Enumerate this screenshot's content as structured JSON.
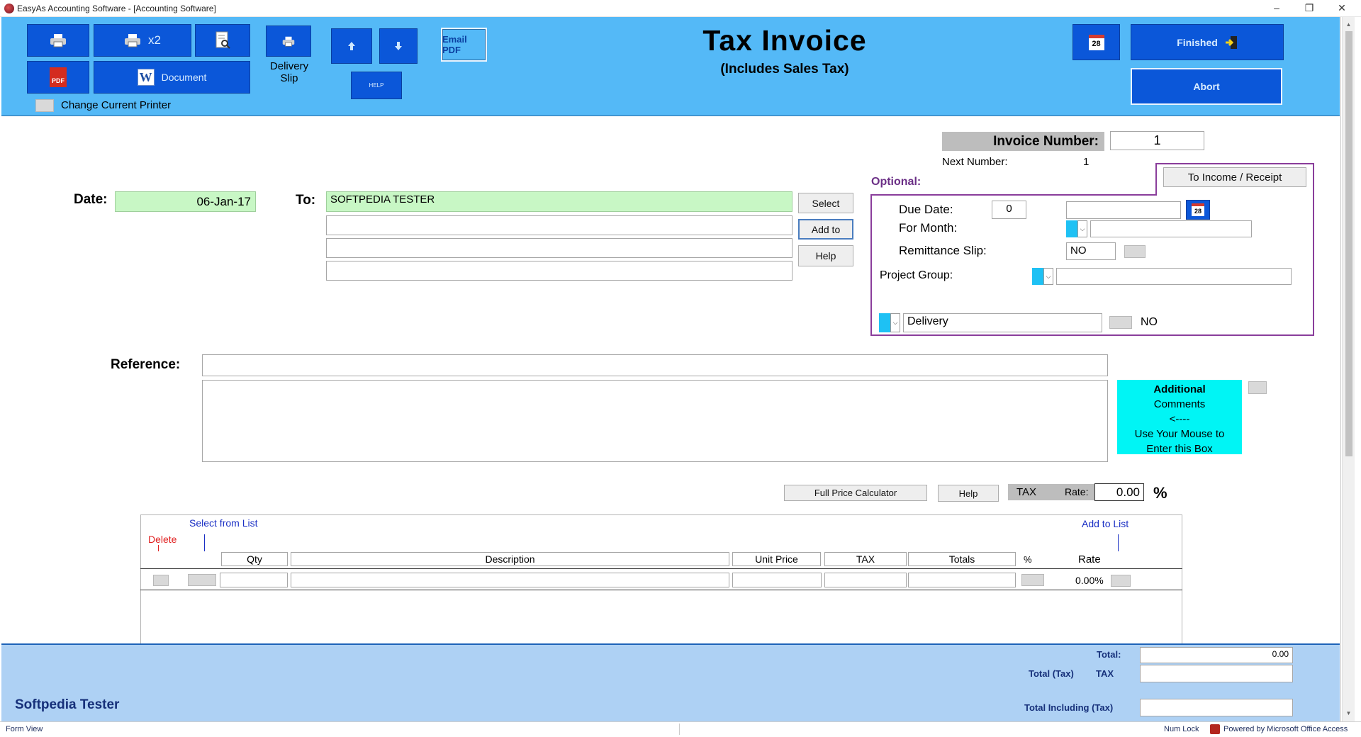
{
  "window": {
    "title": "EasyAs Accounting Software - [Accounting Software]",
    "minimize": "–",
    "restore": "❐",
    "close": "✕"
  },
  "toolbar": {
    "print_x2_label": "x2",
    "document_label": "Document",
    "delivery_slip_label": "Delivery Slip",
    "help_label": "HELP",
    "email_pdf_label": "Email PDF",
    "change_printer_label": "Change Current Printer",
    "pdf_icon_text": "PDF",
    "word_icon_text": "W",
    "calendar_icon_text": "28"
  },
  "header": {
    "title": "Tax  Invoice",
    "subtitle": "(Includes Sales Tax)",
    "finished_label": "Finished",
    "abort_label": "Abort"
  },
  "invoice": {
    "number_label": "Invoice Number:",
    "number_value": "1",
    "next_number_label": "Next Number:",
    "next_number_value": "1"
  },
  "date": {
    "label": "Date:",
    "value": "06-Jan-17"
  },
  "to": {
    "label": "To:",
    "lines": [
      "SOFTPEDIA TESTER",
      "",
      "",
      ""
    ],
    "select_label": "Select",
    "add_to_label": "Add to",
    "help_label": "Help"
  },
  "optional": {
    "label": "Optional:",
    "to_income_label": "To Income / Receipt",
    "due_date_label": "Due Date:",
    "due_date_days": "0",
    "due_date_value": "",
    "for_month_label": "For Month:",
    "for_month_value": "",
    "remittance_label": "Remittance Slip:",
    "remittance_value": "NO",
    "project_group_label": "Project Group:",
    "project_group_value": "",
    "delivery_value": "Delivery",
    "delivery_flag": "NO"
  },
  "reference": {
    "label": "Reference:",
    "value": "",
    "notes": "",
    "additional_comments": [
      "Additional",
      "Comments",
      "<----",
      "Use Your Mouse to",
      "Enter this Box"
    ]
  },
  "calc": {
    "full_price_label": "Full Price Calculator",
    "help_label": "Help",
    "tax_label": "TAX",
    "rate_label": "Rate:",
    "rate_value": "0.00",
    "percent_sign": "%"
  },
  "items": {
    "select_from_list": "Select from List",
    "add_to_list": "Add to List",
    "delete_label": "Delete",
    "columns": [
      "Qty",
      "Description",
      "Unit Price",
      "TAX",
      "Totals"
    ],
    "percent_col": "%",
    "rate_col": "Rate",
    "row_rate": "0.00%"
  },
  "footer": {
    "customer_name": "Softpedia Tester",
    "total_label": "Total:",
    "total_value": "0.00",
    "total_tax_label": "Total (Tax)",
    "tax_label": "TAX",
    "tax_value": "",
    "total_incl_label": "Total Including (Tax)",
    "total_incl_value": ""
  },
  "status": {
    "view": "Form View",
    "num_lock": "Num Lock",
    "powered_by": "Powered by Microsoft Office Access"
  },
  "colors": {
    "header_bg": "#54b9f7",
    "button_blue": "#0b57d9",
    "date_green": "#c8f7c5",
    "optional_border": "#8a3d9b",
    "comments_cyan": "#00f5f5",
    "footer_bg": "#aed1f4"
  }
}
